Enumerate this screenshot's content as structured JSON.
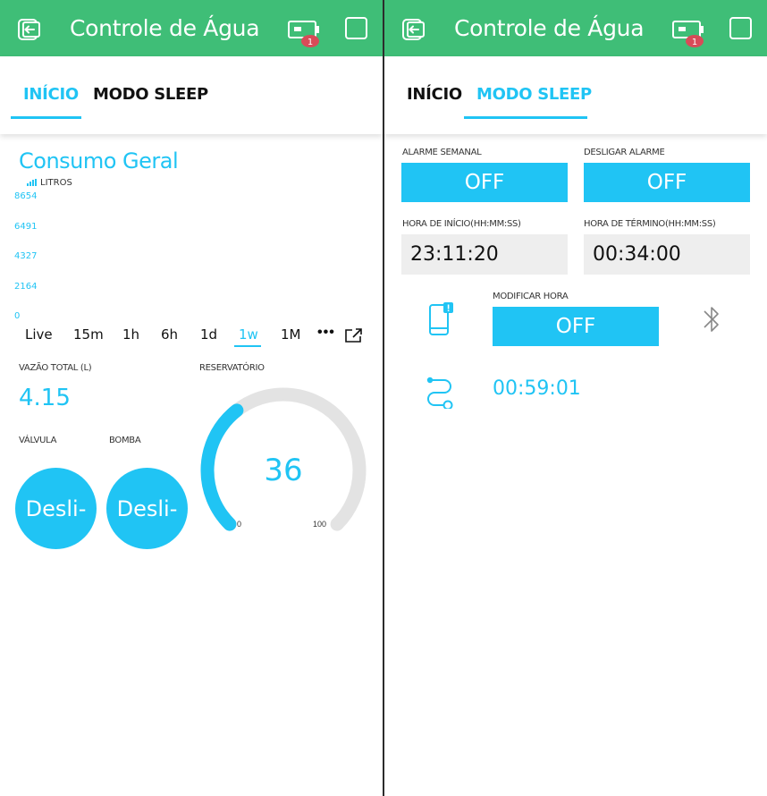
{
  "app": {
    "title": "Controle de Água",
    "notification_count": "1",
    "accent_color": "#20c4f4",
    "header_color": "#3fbe77"
  },
  "tabs": [
    {
      "label": "INÍCIO"
    },
    {
      "label": "MODO SLEEP"
    }
  ],
  "inicio": {
    "chart_title": "Consumo Geral",
    "legend_label": "LITROS",
    "y_ticks": [
      "8654",
      "6491",
      "4327",
      "2164",
      "0"
    ],
    "periods": [
      "Live",
      "15m",
      "1h",
      "6h",
      "1d",
      "1w",
      "1M"
    ],
    "selected_period": "1w",
    "more_label": "•••",
    "vazao_label": "VAZÃO TOTAL (L)",
    "vazao_value": "4.15",
    "reservatorio_label": "RESERVATÓRIO",
    "valvula_label": "VÁLVULA",
    "valvula_button": "Desli-",
    "bomba_label": "BOMBA",
    "bomba_button": "Desli-",
    "gauge_value": "36",
    "gauge_min": "0",
    "gauge_max": "100"
  },
  "chart_data": {
    "type": "bar",
    "title": "Consumo Geral",
    "series": [
      {
        "name": "LITROS",
        "values": []
      }
    ],
    "y_ticks": [
      8654,
      6491,
      4327,
      2164,
      0
    ],
    "ylim": [
      0,
      8654
    ],
    "xlabel": "",
    "ylabel": ""
  },
  "sleep": {
    "alarme_semanal_label": "ALARME SEMANAL",
    "alarme_semanal_button": "OFF",
    "desligar_alarme_label": "DESLIGAR ALARME",
    "desligar_alarme_button": "OFF",
    "hora_inicio_label": "HORA DE INÍCIO(HH:MM:SS)",
    "hora_inicio_value": "23:11:20",
    "hora_termino_label": "HORA DE TÉRMINO(HH:MM:SS)",
    "hora_termino_value": "00:34:00",
    "modificar_hora_label": "MODIFICAR HORA",
    "modificar_hora_button": "OFF",
    "timer_value": "00:59:01"
  },
  "icons": [
    "back-icon",
    "device-icon",
    "square-icon",
    "bar-chart-icon",
    "export-icon",
    "phone-notification-icon",
    "bluetooth-icon",
    "route-icon"
  ]
}
